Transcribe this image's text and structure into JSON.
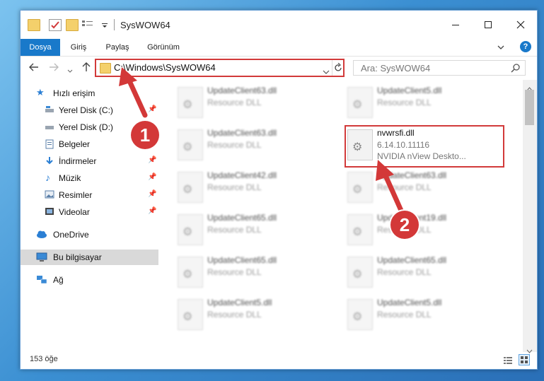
{
  "window": {
    "title": "SysWOW64"
  },
  "ribbon": {
    "tabs": [
      {
        "label": "Dosya",
        "active": true
      },
      {
        "label": "Giriş",
        "active": false
      },
      {
        "label": "Paylaş",
        "active": false
      },
      {
        "label": "Görünüm",
        "active": false
      }
    ],
    "help_glyph": "?"
  },
  "nav": {
    "address": "C:\\Windows\\SysWOW64",
    "search_placeholder": "Ara: SysWOW64"
  },
  "sidebar": {
    "items": [
      {
        "label": "Hızlı erişim",
        "icon": "star-icon",
        "pinned": false
      },
      {
        "label": "Yerel Disk (C:)",
        "icon": "drive-icon",
        "pinned": true
      },
      {
        "label": "Yerel Disk (D:)",
        "icon": "drive-icon",
        "pinned": false
      },
      {
        "label": "Belgeler",
        "icon": "documents-icon",
        "pinned": true
      },
      {
        "label": "İndirmeler",
        "icon": "download-icon",
        "pinned": true
      },
      {
        "label": "Müzik",
        "icon": "music-icon",
        "pinned": true
      },
      {
        "label": "Resimler",
        "icon": "pictures-icon",
        "pinned": true
      },
      {
        "label": "Videolar",
        "icon": "videos-icon",
        "pinned": true
      },
      {
        "label": "OneDrive",
        "icon": "cloud-icon",
        "pinned": false
      },
      {
        "label": "Bu bilgisayar",
        "icon": "computer-icon",
        "pinned": false,
        "selected": true
      },
      {
        "label": "Ağ",
        "icon": "network-icon",
        "pinned": false
      }
    ]
  },
  "files": {
    "left": [
      {
        "name": "UpdateClient63.dll",
        "desc": "Resource DLL"
      },
      {
        "name": "UpdateClient63.dll",
        "desc": "Resource DLL"
      },
      {
        "name": "UpdateClient42.dll",
        "desc": "Resource DLL"
      },
      {
        "name": "UpdateClient65.dll",
        "desc": "Resource DLL"
      },
      {
        "name": "UpdateClient65.dll",
        "desc": "Resource DLL"
      },
      {
        "name": "UpdateClient5.dll",
        "desc": "Resource DLL"
      }
    ],
    "right": [
      {
        "name": "UpdateClient5.dll",
        "desc": "Resource DLL"
      },
      {
        "name": "UpdateClient63.dll",
        "desc": "Resource DLL"
      },
      {
        "name": "UpdateClient19.dll",
        "desc": "Resource DLL"
      },
      {
        "name": "UpdateClient65.dll",
        "desc": "Resource DLL"
      },
      {
        "name": "UpdateClient5.dll",
        "desc": "Resource DLL"
      }
    ],
    "highlighted": {
      "name": "nvwrsfi.dll",
      "version": "6.14.10.11116",
      "desc": "NVIDIA nView Deskto..."
    }
  },
  "status": {
    "count": "153 öğe"
  },
  "callouts": [
    "1",
    "2"
  ],
  "colors": {
    "accent": "#1979ca",
    "highlight_red": "#d23a3a"
  }
}
